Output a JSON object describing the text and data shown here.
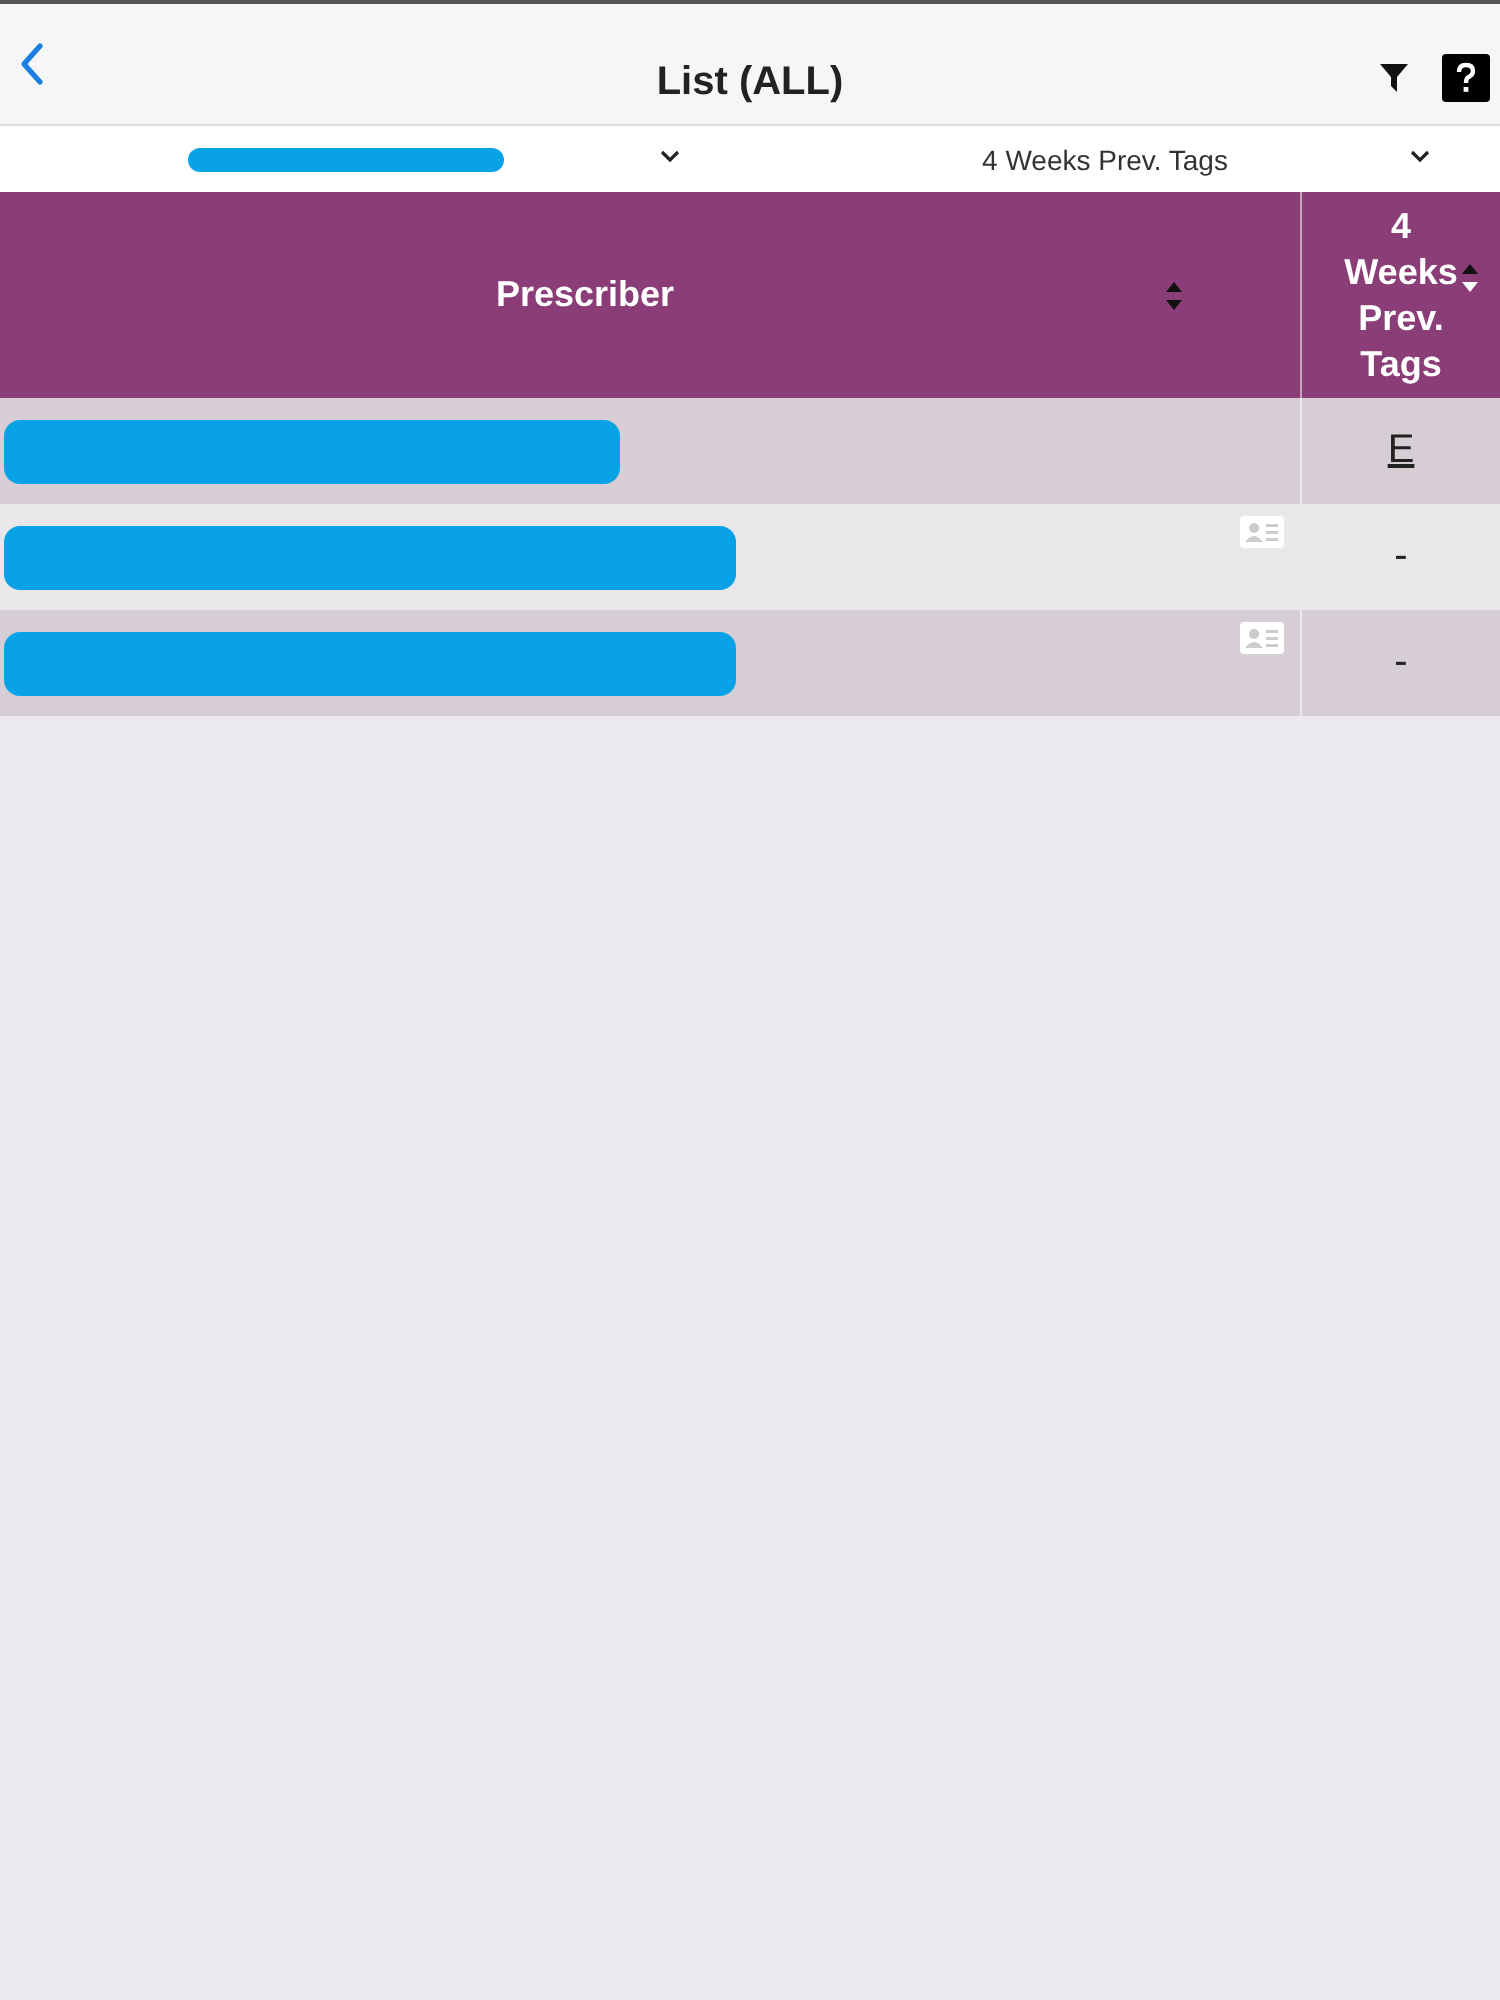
{
  "nav_bar": {
    "title": "List (ALL)"
  },
  "filters": [
    {
      "kind": "redacted"
    },
    {
      "kind": "text",
      "value": "4 Weeks Prev. Tags"
    }
  ],
  "table": {
    "columns": [
      {
        "label": "Prescriber",
        "sorted_descending": false
      },
      {
        "label": "4 Weeks Prev. Tags",
        "sorted_descending": true
      }
    ],
    "rows": [
      {
        "has_card": false,
        "tag": "E",
        "tag_link": true
      },
      {
        "has_card": true,
        "tag": "-",
        "tag_link": false
      },
      {
        "has_card": true,
        "tag": "-",
        "tag_link": false
      }
    ]
  }
}
